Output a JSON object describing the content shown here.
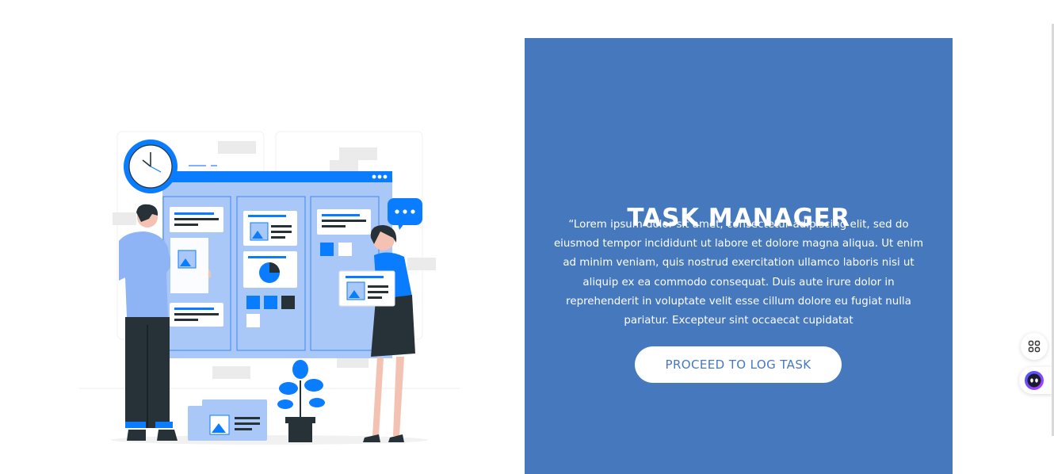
{
  "hero": {
    "title": "TASK MANAGER",
    "description": "“Lorem ipsum dolor sit amet, consectetur adipiscing elit, sed do eiusmod tempor incididunt ut labore et dolore magna aliqua. Ut enim ad minim veniam, quis nostrud exercitation ullamco laboris nisi ut aliquip ex ea commodo consequat. Duis aute irure dolor in reprehenderit in voluptate velit esse cillum dolore eu fugiat nulla pariatur. Excepteur sint occaecat cupidatat",
    "cta_label": "PROCEED TO LOG TASK"
  },
  "colors": {
    "panel_bg": "#4578bd",
    "accent_blue": "#0a7cff",
    "board_light": "#a9c7f7",
    "text_white": "#ffffff"
  },
  "illustration": {
    "icon": "kanban-board-team-illustration"
  },
  "widgets": {
    "apps_icon": "apps-grid-icon",
    "assistant_icon": "assistant-bot-icon"
  }
}
